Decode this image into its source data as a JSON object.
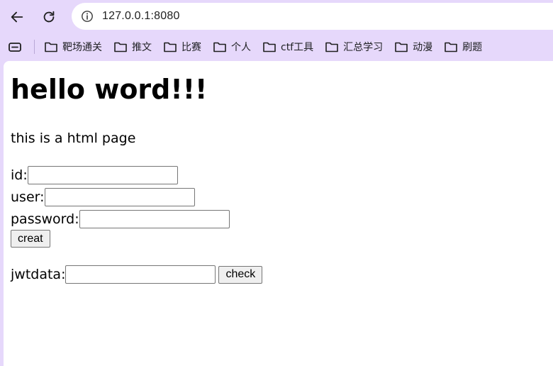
{
  "browser": {
    "url": "127.0.0.1:8080",
    "bookmarks": [
      "靶场通关",
      "推文",
      "比赛",
      "个人",
      "ctf工具",
      "汇总学习",
      "动漫",
      "刷题"
    ]
  },
  "page": {
    "heading": "hello word!!!",
    "intro": "this is a html page",
    "form": {
      "id_label": "id:",
      "id_value": "",
      "user_label": "user:",
      "user_value": "",
      "password_label": "password:",
      "password_value": "",
      "create_button": "creat"
    },
    "jwt": {
      "label": "jwtdata:",
      "value": "",
      "check_button": "check"
    }
  },
  "colors": {
    "chrome_background": "#e6d8fb",
    "page_background": "#ffffff",
    "button_background": "#efefef"
  }
}
